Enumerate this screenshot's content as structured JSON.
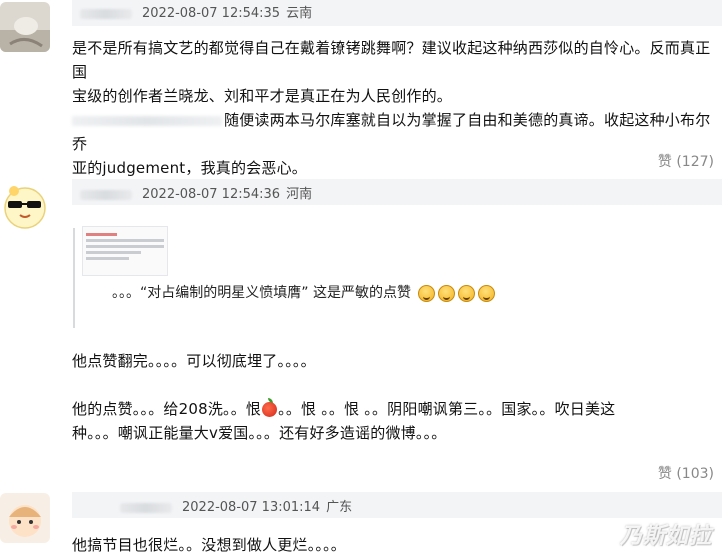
{
  "comments": [
    {
      "time": "2022-08-07 12:54:35",
      "location": "云南",
      "line1": "是不是所有搞文艺的都觉得自己在戴着镣铐跳舞啊？建议收起这种纳西莎似的自怜心。反而真正国",
      "line2": "宝级的创作者兰晓龙、刘和平才是真正在为人民创作的。",
      "line3": "随便读两本马尔库塞就自以为掌握了自由和美德的真谛。收起这种小布尔乔",
      "line4": "亚的judgement，我真的会恶心。",
      "likes": "赞 (127)"
    },
    {
      "time": "2022-08-07 12:54:36",
      "location": "河南",
      "quote": "。。。“对占编制的明星义愤填膺” 这是严敏的点赞",
      "line1": "他点赞翻完。。。。可以彻底埋了。。。。",
      "line2a": "他的点赞。。。给208洗。。恨",
      "line2b": "。。恨    。。恨    。。阴阳嘲讽第三。。国家。。吹日美这",
      "line3": "种。。。嘲讽正能量大v爱国。。。还有好多造谣的微博。。。",
      "likes": "赞 (103)"
    },
    {
      "time": "2022-08-07 13:01:14",
      "location": "广东",
      "line1": "他搞节目也很烂。。没想到做人更烂。。。。"
    }
  ],
  "watermark": "乃斯如拉"
}
